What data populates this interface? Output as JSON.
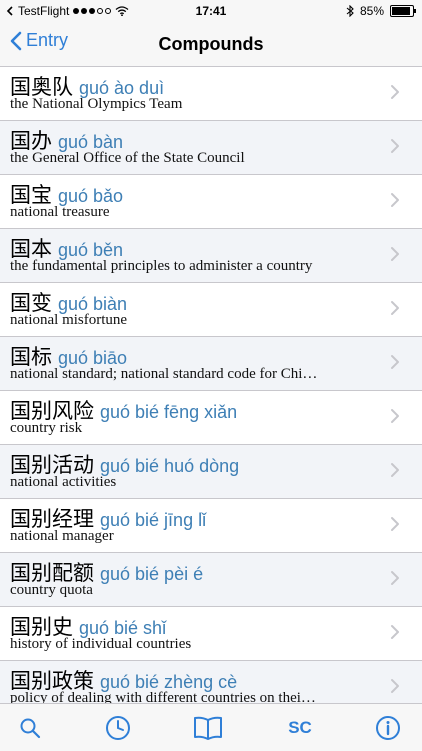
{
  "status_bar": {
    "carrier": "TestFlight",
    "time": "17:41",
    "battery": "85%"
  },
  "nav": {
    "back_label": "Entry",
    "title": "Compounds"
  },
  "compounds": [
    {
      "hanzi": "国奥队",
      "pinyin": "guó ào duì",
      "definition": "the National Olympics Team"
    },
    {
      "hanzi": "国办",
      "pinyin": "guó bàn",
      "definition": "the General Office of the State Council"
    },
    {
      "hanzi": "国宝",
      "pinyin": "guó bǎo",
      "definition": "national treasure"
    },
    {
      "hanzi": "国本",
      "pinyin": "guó běn",
      "definition": "the fundamental principles to administer a country"
    },
    {
      "hanzi": "国变",
      "pinyin": "guó biàn",
      "definition": "national misfortune"
    },
    {
      "hanzi": "国标",
      "pinyin": "guó biāo",
      "definition": "national standard; national standard code for Chi…"
    },
    {
      "hanzi": "国别风险",
      "pinyin": "guó bié fēng xiǎn",
      "definition": "country risk"
    },
    {
      "hanzi": "国别活动",
      "pinyin": "guó bié huó dòng",
      "definition": "national activities"
    },
    {
      "hanzi": "国别经理",
      "pinyin": "guó bié jīng lǐ",
      "definition": "national manager"
    },
    {
      "hanzi": "国别配额",
      "pinyin": "guó bié pèi é",
      "definition": "country quota"
    },
    {
      "hanzi": "国别史",
      "pinyin": "guó bié shǐ",
      "definition": "history of individual countries"
    },
    {
      "hanzi": "国别政策",
      "pinyin": "guó bié zhèng cè",
      "definition": "policy of dealing with different countries on thei…"
    }
  ],
  "tab_bar": {
    "sc_label": "SC",
    "icons": [
      "search-icon",
      "clock-icon",
      "book-icon",
      "info-icon"
    ]
  },
  "colors": {
    "accent": "#2f7fd7",
    "pinyin": "#3e7fb5",
    "alt_row": "#f2f4f8"
  }
}
